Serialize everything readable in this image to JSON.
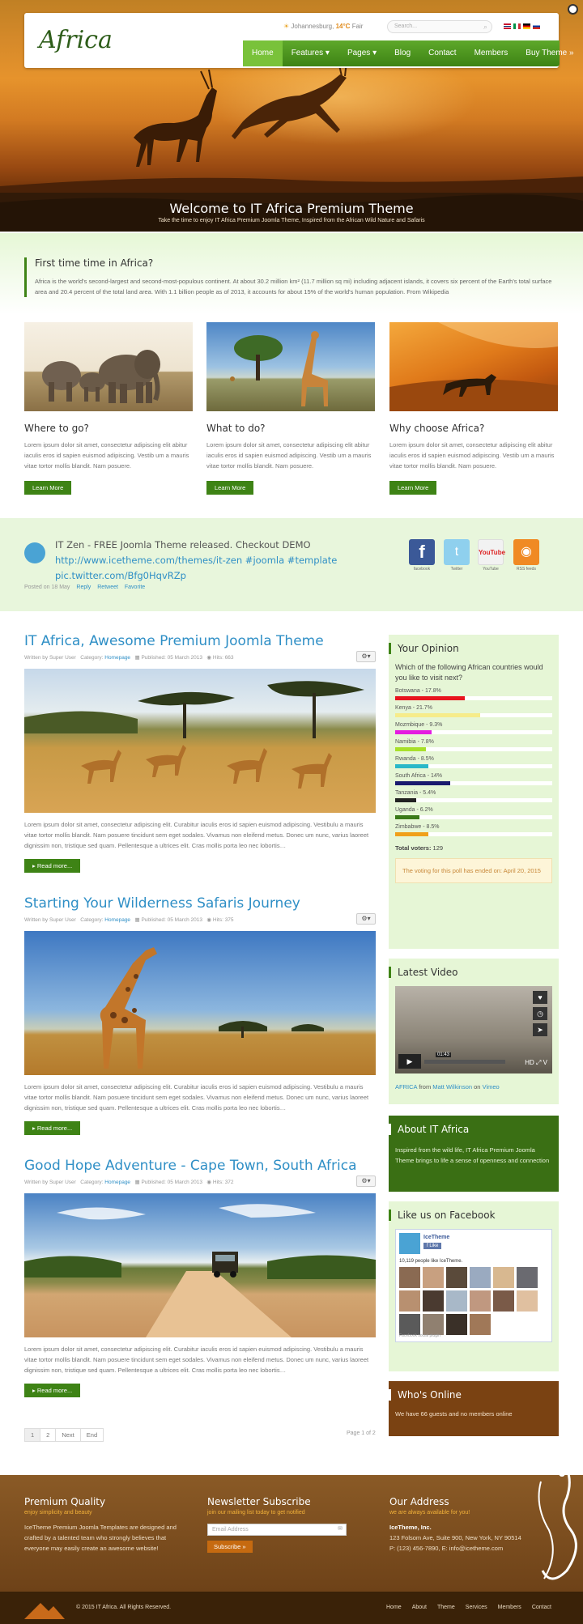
{
  "header": {
    "logo": "Africa",
    "weather": {
      "city": "Johannesburg,",
      "temp": "14°C",
      "condition": "Fair"
    },
    "search_placeholder": "Search...",
    "nav": [
      "Home",
      "Features ▾",
      "Pages ▾",
      "Blog",
      "Contact",
      "Members",
      "Buy Theme »"
    ]
  },
  "hero": {
    "title": "Welcome to IT Africa Premium Theme",
    "subtitle": "Take the time to enjoy IT Africa Premium Joomla Theme, Inspired from the African Wild Nature and Safaris"
  },
  "intro": {
    "title": "First time time in Africa?",
    "text": "Africa is the world's second-largest and second-most-populous continent. At about 30.2 million km² (11.7 million sq mi) including adjacent islands, it covers six percent of the Earth's total surface area and 20.4 percent of the total land area. With 1.1 billion people as of 2013, it accounts for about 15% of the world's human population. From Wikipedia"
  },
  "features": [
    {
      "title": "Where to go?",
      "text": "Lorem ipsum dolor sit amet, consectetur adipiscing elit abitur iaculis eros id sapien euismod adipiscing. Vestib um a mauris vitae tortor mollis blandit. Nam posuere.",
      "button": "Learn More"
    },
    {
      "title": "What to do?",
      "text": "Lorem ipsum dolor sit amet, consectetur adipiscing elit abitur iaculis eros id sapien euismod adipiscing. Vestib um a mauris vitae tortor mollis blandit. Nam posuere.",
      "button": "Learn More"
    },
    {
      "title": "Why choose Africa?",
      "text": "Lorem ipsum dolor sit amet, consectetur adipiscing elit abitur iaculis eros id sapien euismod adipiscing. Vestib um a mauris vitae tortor mollis blandit. Nam posuere.",
      "button": "Learn More"
    }
  ],
  "tweet": {
    "line1": "IT Zen - FREE Joomla Theme released. Checkout DEMO",
    "line2": "http://www.icetheme.com/themes/it-zen #joomla #template",
    "line3": "pic.twitter.com/Bfg0HqvRZp",
    "meta_date": "Posted on 18 May",
    "actions": [
      "Reply",
      "Retweet",
      "Favorite"
    ]
  },
  "social": [
    "facebook",
    "Twitter",
    "YouTube",
    "RSS feeds"
  ],
  "posts": [
    {
      "title": "IT Africa, Awesome Premium Joomla Theme",
      "author": "Written by Super User",
      "category_label": "Category:",
      "category": "Homepage",
      "published": "Published: 05 March 2013",
      "hits": "Hits: 663",
      "text": "Lorem ipsum dolor sit amet, consectetur adipiscing elit. Curabitur iaculis eros id sapien euismod adipiscing. Vestibulu a mauris vitae tortor mollis blandit. Nam posuere tincidunt sem eget sodales. Vivamus non eleifend metus. Donec um nunc, varius laoreet dignissim non, tristique sed quam. Pellentesque a ultrices elit. Cras mollis porta leo nec lobortis…",
      "button": "Read more..."
    },
    {
      "title": "Starting Your Wilderness Safaris Journey",
      "author": "Written by Super User",
      "category_label": "Category:",
      "category": "Homepage",
      "published": "Published: 05 March 2013",
      "hits": "Hits: 375",
      "text": "Lorem ipsum dolor sit amet, consectetur adipiscing elit. Curabitur iaculis eros id sapien euismod adipiscing. Vestibulu a mauris vitae tortor mollis blandit. Nam posuere tincidunt sem eget sodales. Vivamus non eleifend metus. Donec um nunc, varius laoreet dignissim non, tristique sed quam. Pellentesque a ultrices elit. Cras mollis porta leo nec lobortis…",
      "button": "Read more..."
    },
    {
      "title": "Good Hope Adventure - Cape Town, South Africa",
      "author": "Written by Super User",
      "category_label": "Category:",
      "category": "Homepage",
      "published": "Published: 05 March 2013",
      "hits": "Hits: 372",
      "text": "Lorem ipsum dolor sit amet, consectetur adipiscing elit. Curabitur iaculis eros id sapien euismod adipiscing. Vestibulu a mauris vitae tortor mollis blandit. Nam posuere tincidunt sem eget sodales. Vivamus non eleifend metus. Donec um nunc, varius laoreet dignissim non, tristique sed quam. Pellentesque a ultrices elit. Cras mollis porta leo nec lobortis…",
      "button": "Read more..."
    }
  ],
  "pagination": {
    "pages": [
      "1",
      "2",
      "Next",
      "End"
    ],
    "info": "Page 1 of 2"
  },
  "poll": {
    "title": "Your Opinion",
    "question": "Which of the following African countries would you like to visit next?",
    "options": [
      {
        "label": "Botswana - 17.8%",
        "pct": 17.8,
        "color": "#e8141e"
      },
      {
        "label": "Kenya - 21.7%",
        "pct": 21.7,
        "color": "#f6ec8a"
      },
      {
        "label": "Mozmbique - 9.3%",
        "pct": 9.3,
        "color": "#e41ce0"
      },
      {
        "label": "Namibia - 7.8%",
        "pct": 7.8,
        "color": "#a8e02a"
      },
      {
        "label": "Rwanda - 8.5%",
        "pct": 8.5,
        "color": "#2ab8c8"
      },
      {
        "label": "South Africa - 14%",
        "pct": 14,
        "color": "#1a1a6e"
      },
      {
        "label": "Tanzania - 5.4%",
        "pct": 5.4,
        "color": "#222222"
      },
      {
        "label": "Uganda - 6.2%",
        "pct": 6.2,
        "color": "#3a7a18"
      },
      {
        "label": "Zimbabwe - 8.5%",
        "pct": 8.5,
        "color": "#f0a01a"
      }
    ],
    "total_label": "Total voters:",
    "total": "129",
    "ended": "The voting for this poll has ended on: April 20, 2015"
  },
  "video": {
    "title": "Latest Video",
    "time": "01:43",
    "caption_pre": "AFRICA",
    "caption_from": "from",
    "author": "Matt Wilkinson",
    "caption_on": "on",
    "site": "Vimeo"
  },
  "about": {
    "title": "About IT Africa",
    "text": "Inspired from the wild life, IT Africa Premium Joomla Theme brings to life a sense of openness and connection"
  },
  "facebook": {
    "title": "Like us on Facebook",
    "page": "IceTheme",
    "like": "Like",
    "count": "10,119 people like IceTheme.",
    "plugin": "Facebook social plugin"
  },
  "online": {
    "title": "Who's Online",
    "text": "We have 66 guests and no members online"
  },
  "footer": {
    "col1": {
      "title": "Premium Quality",
      "sub": "enjoy simplicity and beauty",
      "text": "IceTheme Premium Joomla Templates are designed and crafted by a talented team who strongly believes that everyone may easily create an awesome website!"
    },
    "col2": {
      "title": "Newsletter Subscribe",
      "sub": "join our mailing list today to get notified",
      "placeholder": "Email Address",
      "button": "Subscribe »"
    },
    "col3": {
      "title": "Our Address",
      "sub": "we are always available for you!",
      "company": "IceTheme, Inc.",
      "address": "123 Folsom Ave, Suite 900, New York, NY 90514",
      "phone": "P: (123) 456-7890, E: info@icetheme.com"
    },
    "copyright": "© 2015 IT Africa. All Rights Reserved.",
    "links": [
      "Home",
      "About",
      "Theme",
      "Services",
      "Members",
      "Contact"
    ]
  },
  "colors": {
    "accent": "#3e8315",
    "link": "#2f8fc6",
    "footer": "#7a4a1c"
  }
}
